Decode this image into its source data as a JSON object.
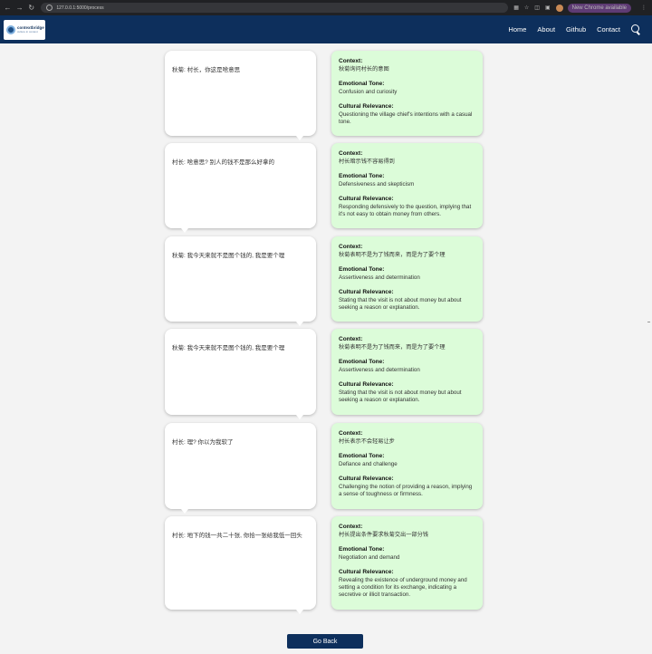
{
  "browser": {
    "url": "127.0.0.1:5000/process",
    "update_label": "New Chrome available"
  },
  "header": {
    "logo_name": "contextbridge",
    "logo_tagline": "culture in context",
    "nav": [
      "Home",
      "About",
      "Github",
      "Contact"
    ]
  },
  "labels": {
    "context": "Context:",
    "tone": "Emotional Tone:",
    "relevance": "Cultural Relevance:"
  },
  "rows": [
    {
      "line": "秋菊: 村长，你这是啥意思",
      "context": "秋菊询问村长的意图",
      "tone": "Confusion and curiosity",
      "relevance": "Questioning the village chief's intentions with a casual tone."
    },
    {
      "line": "村长: 啥意思? 别人的钱不是那么好拿的",
      "context": "村长暗示钱不容易得到",
      "tone": "Defensiveness and skepticism",
      "relevance": "Responding defensively to the question, implying that it's not easy to obtain money from others."
    },
    {
      "line": "秋菊: 我今天来就不是图个钱的, 我是要个理",
      "context": "秋菊表明不是为了钱而来，而是为了要个理",
      "tone": "Assertiveness and determination",
      "relevance": "Stating that the visit is not about money but about seeking a reason or explanation."
    },
    {
      "line": "秋菊: 我今天来就不是图个钱的, 我是要个理",
      "context": "秋菊表明不是为了钱而来，而是为了要个理",
      "tone": "Assertiveness and determination",
      "relevance": "Stating that the visit is not about money but about seeking a reason or explanation."
    },
    {
      "line": "村长: 理? 你以为我软了",
      "context": "村长表示不会轻易让步",
      "tone": "Defiance and challenge",
      "relevance": "Challenging the notion of providing a reason, implying a sense of toughness or firmness."
    },
    {
      "line": "村长: 地下的钱一共二十张, 你拾一张给我低一回头",
      "context": "村长提出条件要求秋菊交出一部分钱",
      "tone": "Negotiation and demand",
      "relevance": "Revealing the existence of underground money and setting a condition for its exchange, indicating a secretive or illicit transaction."
    }
  ],
  "go_back": "Go Back"
}
